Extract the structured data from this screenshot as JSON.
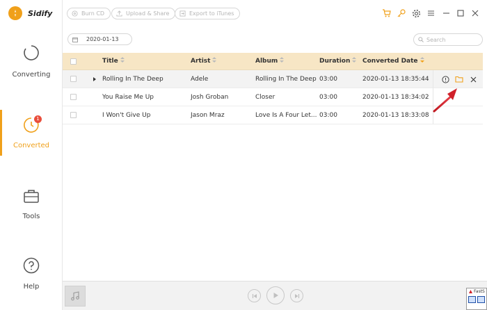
{
  "app": {
    "title": "Sidify"
  },
  "sidebar": {
    "items": [
      {
        "label": "Converting",
        "icon": "spinner-icon"
      },
      {
        "label": "Converted",
        "icon": "clock-icon",
        "badge": "1"
      },
      {
        "label": "Tools",
        "icon": "toolbox-icon"
      },
      {
        "label": "Help",
        "icon": "question-icon"
      }
    ]
  },
  "toolbar": {
    "burn_cd": "Burn CD",
    "upload_share": "Upload & Share",
    "export_itunes": "Export to iTunes"
  },
  "filter": {
    "date": "2020-01-13",
    "search_placeholder": "Search"
  },
  "table": {
    "headers": {
      "title": "Title",
      "artist": "Artist",
      "album": "Album",
      "duration": "Duration",
      "converted_date": "Converted Date"
    },
    "rows": [
      {
        "title": "Rolling In The Deep",
        "artist": "Adele",
        "album": "Rolling In The Deep",
        "duration": "03:00",
        "converted_date": "2020-01-13 18:35:44"
      },
      {
        "title": "You Raise Me Up",
        "artist": "Josh Groban",
        "album": "Closer",
        "duration": "03:00",
        "converted_date": "2020-01-13 18:34:02"
      },
      {
        "title": "I Won't Give Up",
        "artist": "Jason Mraz",
        "album": "Love Is A Four Let...",
        "duration": "03:00",
        "converted_date": "2020-01-13 18:33:08"
      }
    ]
  },
  "taskbar": {
    "label": "FastS"
  },
  "colors": {
    "accent": "#f0a01a",
    "header_bg": "#f7e6c5",
    "arrow": "#d0212a"
  }
}
